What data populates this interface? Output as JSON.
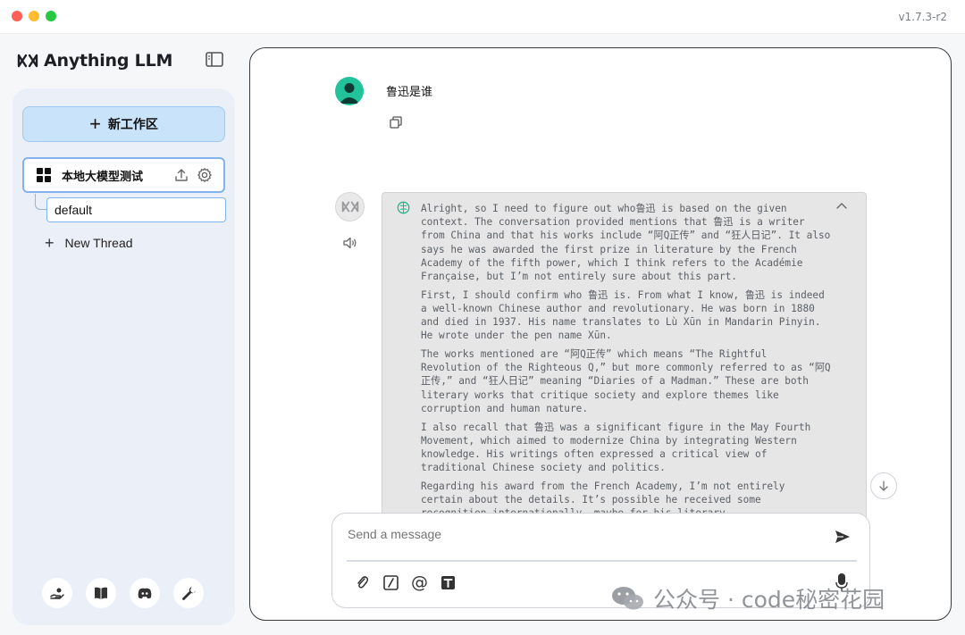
{
  "app": {
    "version": "v1.7.3-r2",
    "name": "Anything LLM"
  },
  "sidebar": {
    "new_workspace_label": "新工作区",
    "workspace": {
      "name": "本地大模型测试",
      "active_thread": "default"
    },
    "new_thread_label": "New Thread",
    "bottom_icons": [
      "community-hub-icon",
      "docs-icon",
      "discord-icon",
      "settings-wrench-icon"
    ]
  },
  "chat": {
    "user_message": "鲁迅是谁",
    "thought_paragraphs": [
      "Alright, so I need to figure out who鲁迅 is based on the given context. The conversation provided mentions that 鲁迅 is a writer from China and that his works include “阿Q正传” and “狂人日记”. It also says he was awarded the first prize in literature by the French Academy of the fifth power, which I think refers to the Académie Française, but I’m not entirely sure about this part.",
      "First, I should confirm who 鲁迅 is. From what I know, 鲁迅 is indeed a well-known Chinese author and revolutionary. He was born in 1880 and died in 1937. His name translates to Lù Xūn in Mandarin Pinyin. He wrote under the pen name Xūn.",
      "The works mentioned are “阿Q正传” which means “The Rightful Revolution of the Righteous Q,” but more commonly referred to as “阿Q正传,” and “狂人日记” meaning “Diaries of a Madman.” These are both literary works that critique society and explore themes like corruption and human nature.",
      "I also recall that 鲁迅 was a significant figure in the May Fourth Movement, which aimed to modernize China by integrating Western knowledge. His writings often expressed a critical view of traditional Chinese society and politics.",
      "Regarding his award from the French Academy, I’m not entirely certain about the details. It’s possible he received some recognition internationally, maybe for his literary"
    ]
  },
  "composer": {
    "placeholder": "Send a message"
  },
  "watermark": {
    "text": "公众号 · code秘密花园"
  },
  "colors": {
    "accent_blue": "#c9e3fb",
    "accent_border": "#7fb4ee",
    "user_avatar": "#22c39a"
  }
}
